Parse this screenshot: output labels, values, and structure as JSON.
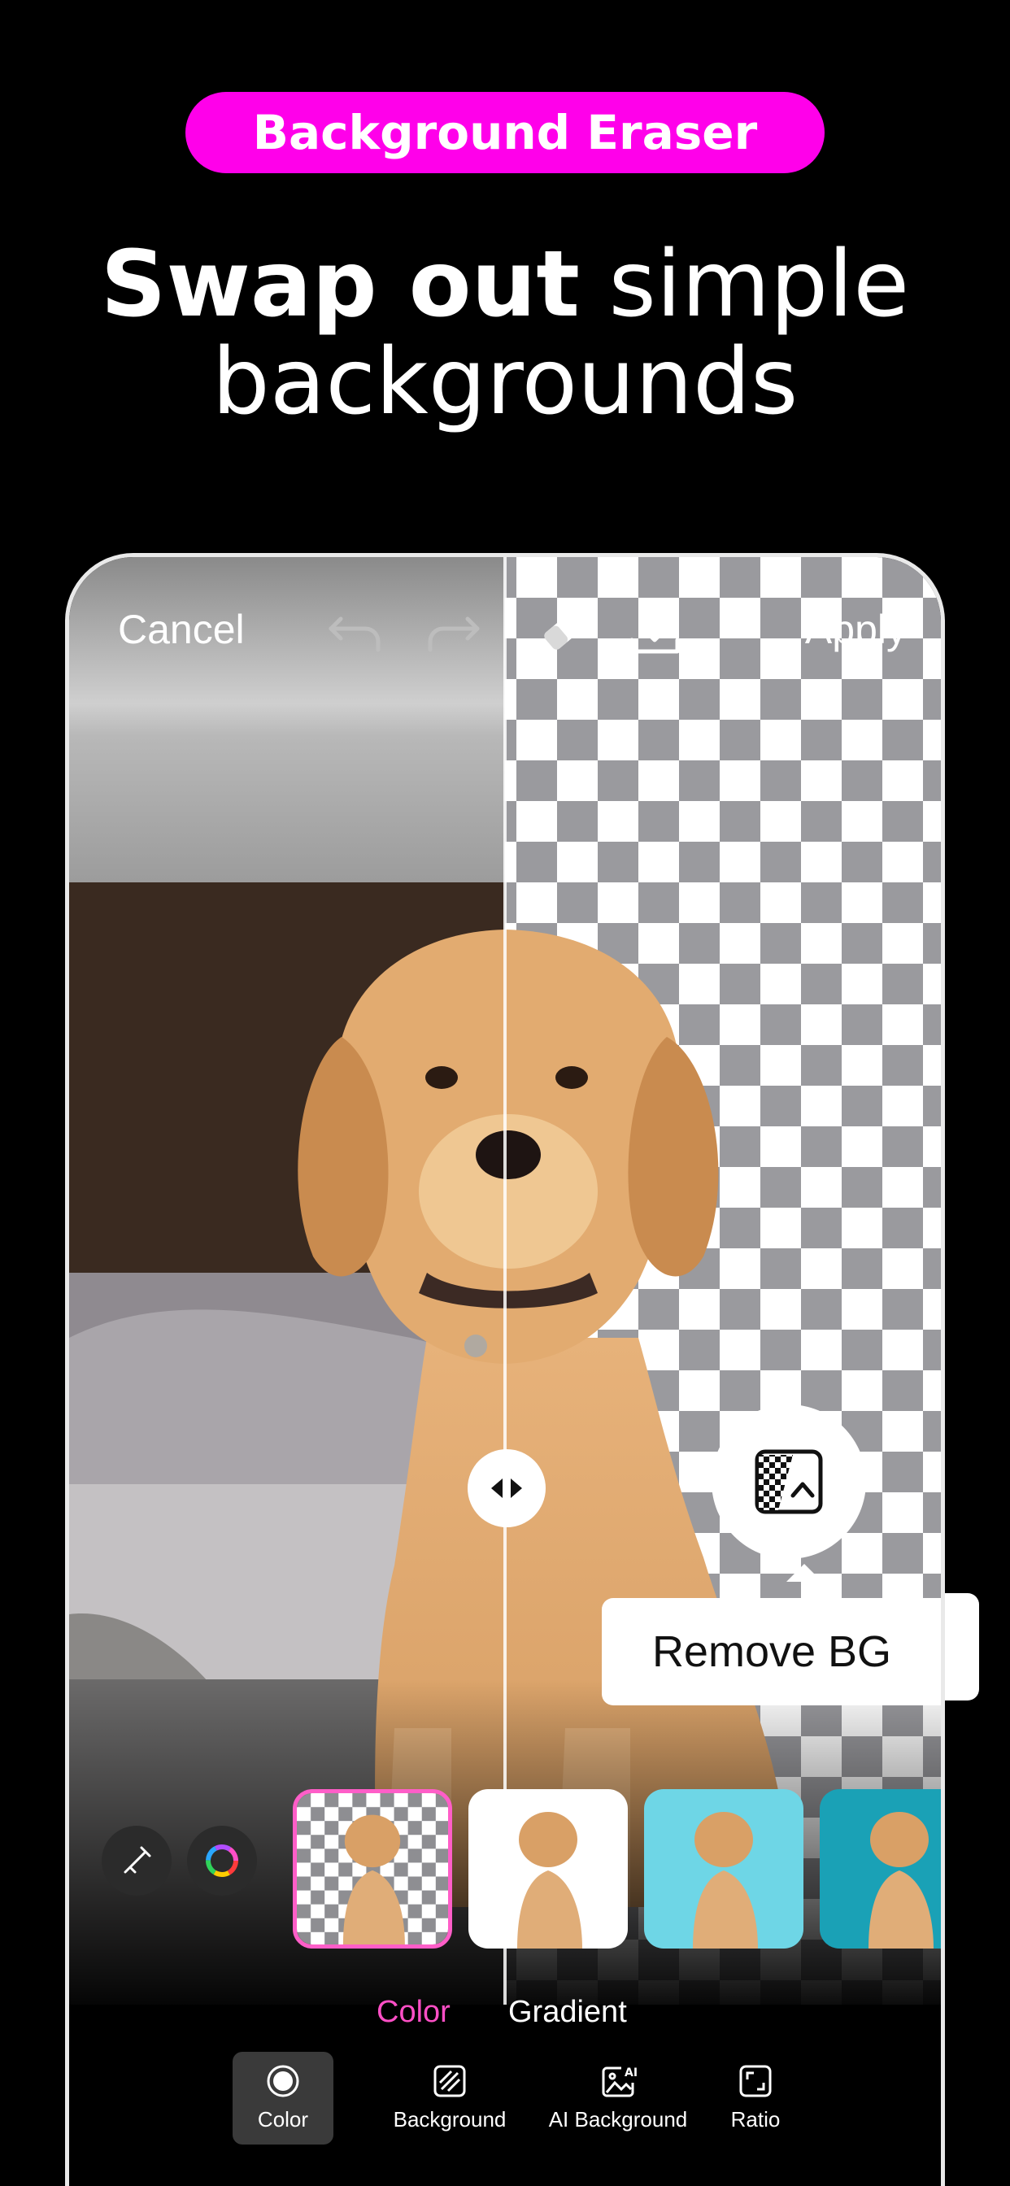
{
  "header": {
    "badge_label": "Background Eraser",
    "headline_bold": "Swap out",
    "headline_rest": "simple",
    "headline_line2": "backgrounds"
  },
  "editor": {
    "topbar": {
      "cancel_label": "Cancel",
      "apply_label": "Apply",
      "icons": [
        "undo-icon",
        "redo-icon",
        "eraser-icon",
        "download-icon"
      ]
    },
    "remove_bg": {
      "label": "Remove BG",
      "icon": "remove-bg-icon"
    },
    "tools": [
      "eyedropper-icon",
      "color-wheel-icon"
    ],
    "thumbnails": [
      {
        "kind": "transparent",
        "selected": true
      },
      {
        "kind": "white",
        "color": "#ffffff"
      },
      {
        "kind": "cyan",
        "color": "#6ed6e6"
      },
      {
        "kind": "teal",
        "color": "#1aa1b6"
      }
    ],
    "tabs": [
      {
        "label": "Color",
        "active": true
      },
      {
        "label": "Gradient",
        "active": false
      }
    ],
    "nav": [
      {
        "label": "Color",
        "icon": "color-circle-icon",
        "active": true
      },
      {
        "label": "Background",
        "icon": "background-pattern-icon",
        "active": false
      },
      {
        "label": "AI Background",
        "icon": "ai-background-icon",
        "active": false
      },
      {
        "label": "Ratio",
        "icon": "ratio-icon",
        "active": false
      }
    ]
  },
  "colors": {
    "accent": "#ff00ea",
    "active_tab": "#ff4fc6"
  }
}
